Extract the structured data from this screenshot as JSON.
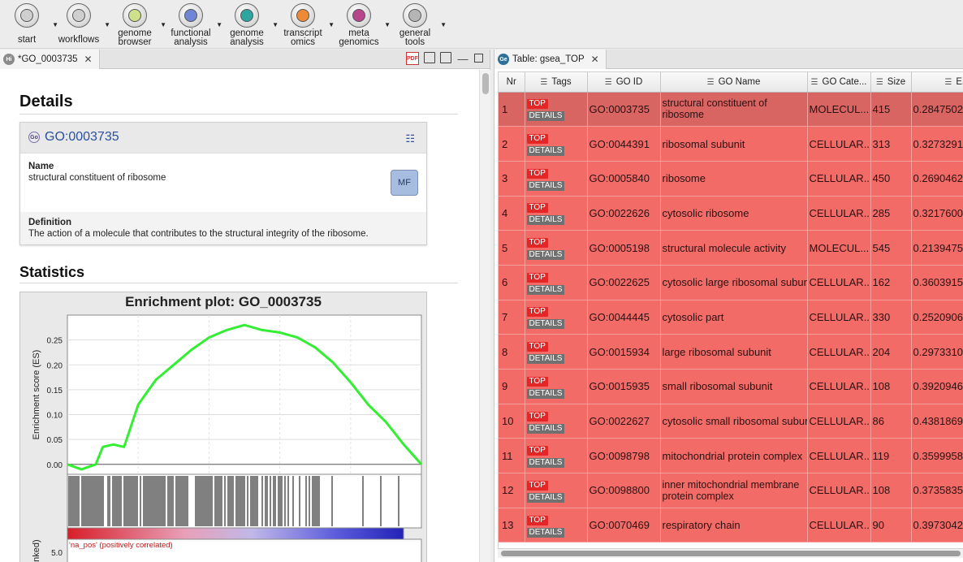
{
  "toolbar": {
    "items": [
      {
        "label": "start",
        "icon": "start-icon",
        "color": "#cfcfcf"
      },
      {
        "label": "workflows",
        "icon": "share-icon",
        "color": "#cfcfcf"
      },
      {
        "label": "genome\nbrowser",
        "icon": "genome-browser-icon",
        "color": "#cfe08a"
      },
      {
        "label": "functional\nanalysis",
        "icon": "functional-analysis-icon",
        "color": "#6f86d6"
      },
      {
        "label": "genome\nanalysis",
        "icon": "genome-analysis-icon",
        "color": "#2fa5a0"
      },
      {
        "label": "transcript\nomics",
        "icon": "transcriptomics-icon",
        "color": "#ee8a35"
      },
      {
        "label": "meta\ngenomics",
        "icon": "metagenomics-icon",
        "color": "#b8468c"
      },
      {
        "label": "general\ntools",
        "icon": "general-tools-icon",
        "color": "#b5b5b5"
      }
    ]
  },
  "left": {
    "tab_label": "*GO_0003735",
    "tab_badge": "Hi",
    "details_title": "Details",
    "go_id": "GO:0003735",
    "name_label": "Name",
    "name_value": "structural constituent of ribosome",
    "badge": "MF",
    "definition_label": "Definition",
    "definition_value": "The action of a molecule that contributes to the structural integrity of the ribosome.",
    "statistics_title": "Statistics",
    "plot_title": "Enrichment plot: GO_0003735",
    "ylabel": "Enrichment score (ES)",
    "ylabel2": "anked)",
    "yticks": [
      "0.25",
      "0.20",
      "0.15",
      "0.10",
      "0.05",
      "0.00"
    ],
    "bottom_tick": "5.0",
    "na_pos_label": "'na_pos' (positively correlated)"
  },
  "chart_data": {
    "type": "line",
    "title": "Enrichment plot: GO_0003735",
    "ylabel": "Enrichment score (ES)",
    "ylim": [
      -0.02,
      0.3
    ],
    "x": [
      0,
      4,
      8,
      10,
      13,
      16,
      20,
      25,
      30,
      35,
      40,
      45,
      50,
      55,
      60,
      65,
      70,
      75,
      80,
      85,
      90,
      95,
      100
    ],
    "series": [
      {
        "values": [
          0.0,
          -0.01,
          0.0,
          0.035,
          0.04,
          0.035,
          0.12,
          0.17,
          0.2,
          0.23,
          0.255,
          0.27,
          0.28,
          0.27,
          0.265,
          0.255,
          0.235,
          0.205,
          0.165,
          0.12,
          0.085,
          0.04,
          0.0
        ]
      }
    ],
    "grid": true
  },
  "table": {
    "tab_label": "Table: gsea_TOP",
    "tab_badge": "Ge",
    "columns": [
      "Nr",
      "Tags",
      "GO ID",
      "GO Name",
      "GO Cate...",
      "Size",
      "ES"
    ],
    "tag_top": "TOP",
    "tag_details": "DETAILS",
    "rows": [
      {
        "nr": "1",
        "id": "GO:0003735",
        "name": "structural constituent of ribosome",
        "cat": "MOLECUL...",
        "size": "415",
        "es": "0.2847502"
      },
      {
        "nr": "2",
        "id": "GO:0044391",
        "name": "ribosomal subunit",
        "cat": "CELLULAR...",
        "size": "313",
        "es": "0.3273291"
      },
      {
        "nr": "3",
        "id": "GO:0005840",
        "name": "ribosome",
        "cat": "CELLULAR...",
        "size": "450",
        "es": "0.2690462"
      },
      {
        "nr": "4",
        "id": "GO:0022626",
        "name": "cytosolic ribosome",
        "cat": "CELLULAR...",
        "size": "285",
        "es": "0.3217600"
      },
      {
        "nr": "5",
        "id": "GO:0005198",
        "name": "structural molecule activity",
        "cat": "MOLECUL...",
        "size": "545",
        "es": "0.2139475"
      },
      {
        "nr": "6",
        "id": "GO:0022625",
        "name": "cytosolic large ribosomal subunit",
        "cat": "CELLULAR...",
        "size": "162",
        "es": "0.3603915"
      },
      {
        "nr": "7",
        "id": "GO:0044445",
        "name": "cytosolic part",
        "cat": "CELLULAR...",
        "size": "330",
        "es": "0.2520906"
      },
      {
        "nr": "8",
        "id": "GO:0015934",
        "name": "large ribosomal subunit",
        "cat": "CELLULAR...",
        "size": "204",
        "es": "0.2973310"
      },
      {
        "nr": "9",
        "id": "GO:0015935",
        "name": "small ribosomal subunit",
        "cat": "CELLULAR...",
        "size": "108",
        "es": "0.3920946"
      },
      {
        "nr": "10",
        "id": "GO:0022627",
        "name": "cytosolic small ribosomal subunit",
        "cat": "CELLULAR...",
        "size": "86",
        "es": "0.4381869"
      },
      {
        "nr": "11",
        "id": "GO:0098798",
        "name": "mitochondrial protein complex",
        "cat": "CELLULAR...",
        "size": "119",
        "es": "0.3599958"
      },
      {
        "nr": "12",
        "id": "GO:0098800",
        "name": "inner mitochondrial membrane protein complex",
        "cat": "CELLULAR...",
        "size": "108",
        "es": "0.3735835"
      },
      {
        "nr": "13",
        "id": "GO:0070469",
        "name": "respiratory chain",
        "cat": "CELLULAR...",
        "size": "90",
        "es": "0.3973042"
      }
    ]
  }
}
